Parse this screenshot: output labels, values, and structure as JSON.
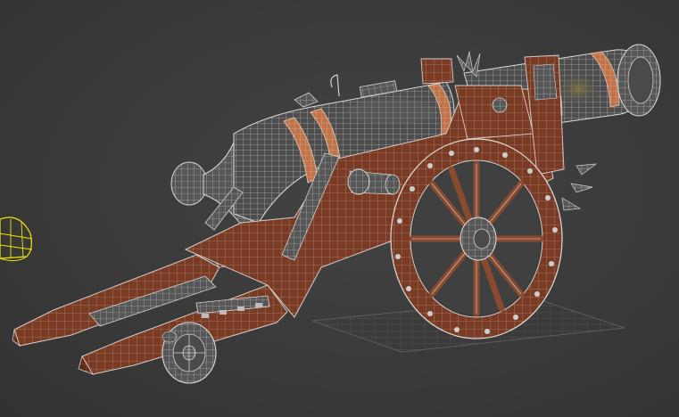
{
  "viewport": {
    "mode": "perspective-wireframe-over-shaded",
    "background_color": "#3b3b3b",
    "wire_color": "#d0d0d0",
    "wood_color": "#7a3b24",
    "wood_dark_color": "#5a2a18",
    "metal_color": "#5b5b5b",
    "copper_color": "#c8794e",
    "selection_color": "#f2e600"
  },
  "scene": {
    "object": "cannon",
    "parts": [
      "barrel",
      "carriage",
      "large-wheel",
      "small-wheel",
      "trail",
      "ground-grid",
      "helper-gizmo"
    ]
  }
}
